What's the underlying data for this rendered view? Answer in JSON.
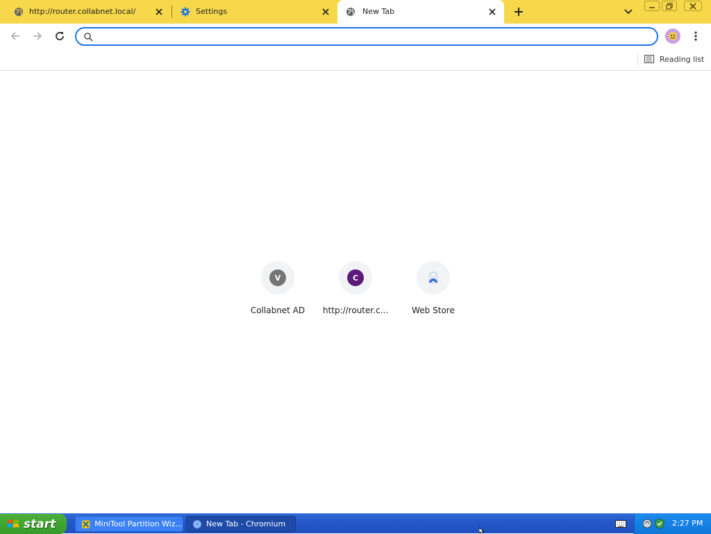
{
  "tabs": [
    {
      "title": "http://router.collabnet.local/",
      "icon": "globe-icon"
    },
    {
      "title": "Settings",
      "icon": "gear-icon"
    },
    {
      "title": "New Tab",
      "icon": "globe-icon",
      "active": true
    }
  ],
  "omnibox": {
    "value": "",
    "placeholder": ""
  },
  "bookmarks_bar": {
    "reading_list_label": "Reading list"
  },
  "shortcuts": [
    {
      "label": "Collabnet AD",
      "letter": "V",
      "color": "#757575"
    },
    {
      "label": "http://router.c...",
      "letter": "C",
      "color": "#5c1a7a"
    },
    {
      "label": "Web Store",
      "icon": "webstore-icon"
    }
  ],
  "taskbar": {
    "start_label": "start",
    "tasks": [
      {
        "label": "MiniTool Partition Wiz...",
        "icon": "minitool-icon"
      },
      {
        "label": "New Tab - Chromium",
        "icon": "chromium-icon",
        "active": true
      }
    ],
    "clock": "2:27 PM"
  },
  "colors": {
    "tabstrip": "#f7d84a",
    "accent": "#1a73e8",
    "taskbar": "#2458c8"
  }
}
